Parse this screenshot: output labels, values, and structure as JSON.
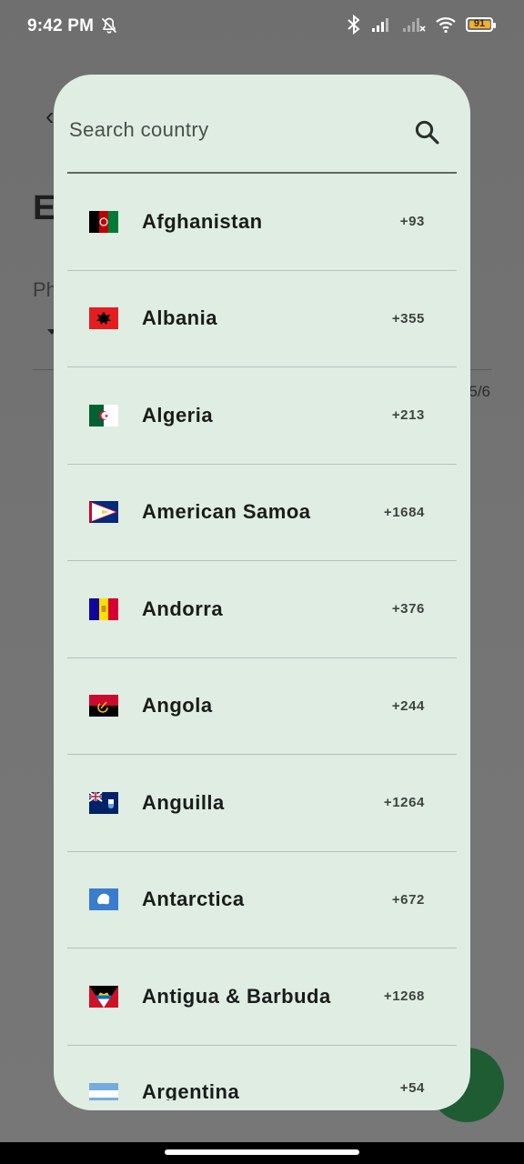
{
  "status_bar": {
    "time": "9:42 PM",
    "battery_level": "91",
    "icons": [
      "bell-off-icon",
      "bluetooth-icon",
      "signal-icon",
      "signal-no-service-icon",
      "wifi-icon",
      "battery-icon"
    ]
  },
  "background": {
    "title_fragment": "E",
    "field_label_fragment": "Ph",
    "counter_fragment": "5/6"
  },
  "dialog": {
    "search": {
      "placeholder": "Search country",
      "icon": "search-icon"
    },
    "countries": [
      {
        "name": "Afghanistan",
        "code": "+93",
        "flag": "afghanistan-flag-icon"
      },
      {
        "name": "Albania",
        "code": "+355",
        "flag": "albania-flag-icon"
      },
      {
        "name": "Algeria",
        "code": "+213",
        "flag": "algeria-flag-icon"
      },
      {
        "name": "American Samoa",
        "code": "+1684",
        "flag": "american-samoa-flag-icon"
      },
      {
        "name": "Andorra",
        "code": "+376",
        "flag": "andorra-flag-icon"
      },
      {
        "name": "Angola",
        "code": "+244",
        "flag": "angola-flag-icon"
      },
      {
        "name": "Anguilla",
        "code": "+1264",
        "flag": "anguilla-flag-icon"
      },
      {
        "name": "Antarctica",
        "code": "+672",
        "flag": "antarctica-flag-icon"
      },
      {
        "name": "Antigua & Barbuda",
        "code": "+1268",
        "flag": "antigua-barbuda-flag-icon"
      },
      {
        "name": "Argentina",
        "code": "+54",
        "flag": "argentina-flag-icon"
      }
    ]
  },
  "colors": {
    "dialog_bg": "#dfede3",
    "fab": "#1f5c34",
    "battery": "#f2b12a"
  }
}
